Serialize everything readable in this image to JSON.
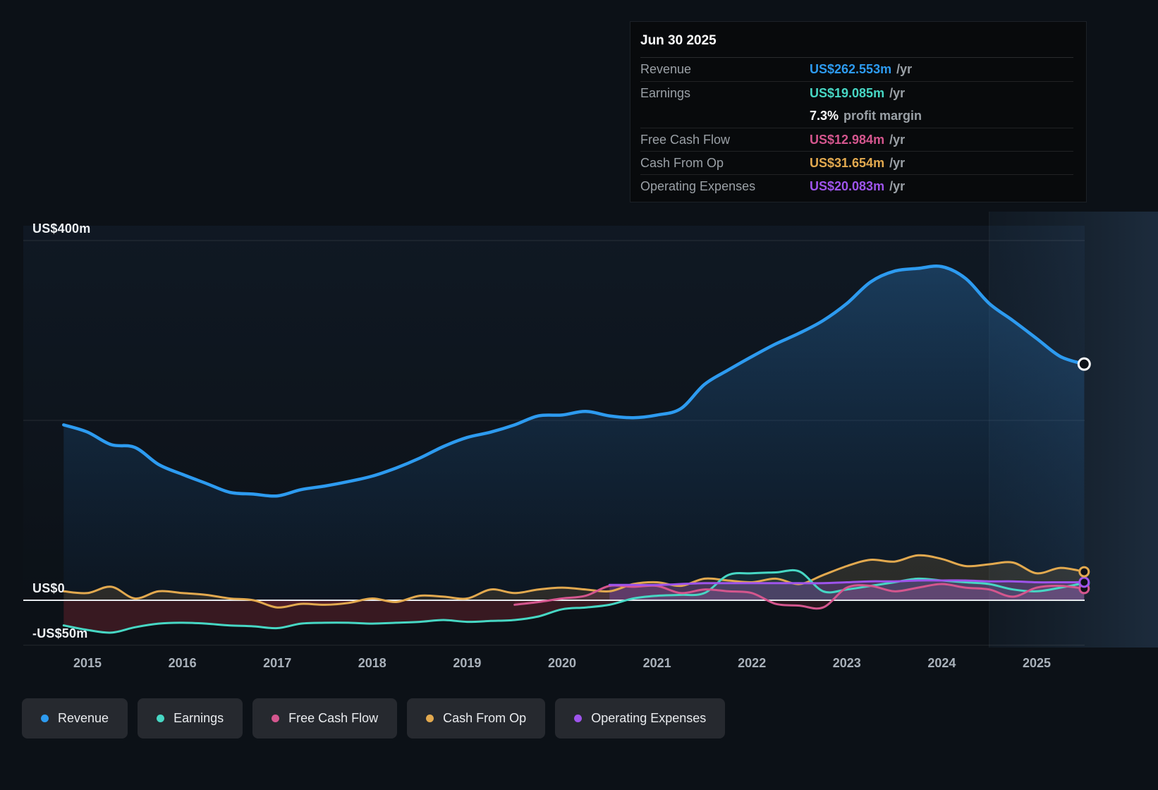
{
  "tooltip": {
    "date": "Jun 30 2025",
    "rows": [
      {
        "label": "Revenue",
        "value": "US$262.553m",
        "suffix": "/yr",
        "series": "revenue"
      },
      {
        "label": "Earnings",
        "value": "US$19.085m",
        "suffix": "/yr",
        "series": "earnings"
      },
      {
        "label": "",
        "value": "7.3%",
        "suffix": "profit margin",
        "series": "margin"
      },
      {
        "label": "Free Cash Flow",
        "value": "US$12.984m",
        "suffix": "/yr",
        "series": "fcf"
      },
      {
        "label": "Cash From Op",
        "value": "US$31.654m",
        "suffix": "/yr",
        "series": "cashop"
      },
      {
        "label": "Operating Expenses",
        "value": "US$20.083m",
        "suffix": "/yr",
        "series": "opex"
      }
    ]
  },
  "colors": {
    "revenue": "#2d9bf0",
    "earnings": "#47d7c4",
    "fcf": "#d4568e",
    "cashop": "#e2a94f",
    "opex": "#9e54ec",
    "margin": "#ffffff",
    "zero_line": "#e6eaee",
    "gridline": "rgba(255,255,255,0.10)"
  },
  "chart_data": {
    "type": "area",
    "unit": "US$m",
    "title": "",
    "xlabel": "",
    "ylabel": "",
    "ylim": [
      -75,
      430
    ],
    "xlim": [
      2014.3,
      2025.5
    ],
    "highlight_from": 2024.5,
    "x_ticks": [
      2015,
      2016,
      2017,
      2018,
      2019,
      2020,
      2021,
      2022,
      2023,
      2024,
      2025
    ],
    "y_gridlines": [
      {
        "value": 400,
        "label": "US$400m"
      },
      {
        "value": 200,
        "label": ""
      },
      {
        "value": 0,
        "label": "US$0"
      },
      {
        "value": -50,
        "label": "-US$50m"
      }
    ],
    "series": [
      {
        "id": "revenue",
        "name": "Revenue",
        "x": [
          2014.75,
          2015,
          2015.25,
          2015.5,
          2015.75,
          2016,
          2016.25,
          2016.5,
          2016.75,
          2017,
          2017.25,
          2017.5,
          2017.75,
          2018,
          2018.25,
          2018.5,
          2018.75,
          2019,
          2019.25,
          2019.5,
          2019.75,
          2020,
          2020.25,
          2020.5,
          2020.75,
          2021,
          2021.25,
          2021.5,
          2021.75,
          2022,
          2022.25,
          2022.5,
          2022.75,
          2023,
          2023.25,
          2023.5,
          2023.75,
          2024,
          2024.25,
          2024.5,
          2024.75,
          2025,
          2025.25,
          2025.5
        ],
        "values": [
          195,
          187,
          173,
          170,
          151,
          140,
          130,
          120,
          118,
          116,
          123,
          127,
          132,
          138,
          147,
          158,
          171,
          181,
          187,
          195,
          205,
          206,
          210,
          205,
          203,
          206,
          213,
          240,
          256,
          271,
          285,
          297,
          311,
          330,
          354,
          366,
          369,
          371,
          358,
          330,
          311,
          291,
          271,
          262.6
        ]
      },
      {
        "id": "earnings",
        "name": "Earnings",
        "x": [
          2014.75,
          2015,
          2015.25,
          2015.5,
          2015.75,
          2016,
          2016.25,
          2016.5,
          2016.75,
          2017,
          2017.25,
          2017.5,
          2017.75,
          2018,
          2018.25,
          2018.5,
          2018.75,
          2019,
          2019.25,
          2019.5,
          2019.75,
          2020,
          2020.25,
          2020.5,
          2020.75,
          2021,
          2021.25,
          2021.5,
          2021.75,
          2022,
          2022.25,
          2022.5,
          2022.75,
          2023,
          2023.25,
          2023.5,
          2023.75,
          2024,
          2024.25,
          2024.5,
          2024.75,
          2025,
          2025.25,
          2025.5
        ],
        "values": [
          -28,
          -33,
          -36,
          -30,
          -26,
          -25,
          -26,
          -28,
          -29,
          -31,
          -26,
          -25,
          -25,
          -26,
          -25,
          -24,
          -22,
          -24,
          -23,
          -22,
          -18,
          -10,
          -8,
          -5,
          2,
          5,
          6,
          8,
          28,
          30,
          31,
          32,
          10,
          12,
          16,
          20,
          24,
          22,
          20,
          18,
          12,
          10,
          14,
          19.1
        ]
      },
      {
        "id": "cashop",
        "name": "Cash From Op",
        "x": [
          2014.75,
          2015,
          2015.25,
          2015.5,
          2015.75,
          2016,
          2016.25,
          2016.5,
          2016.75,
          2017,
          2017.25,
          2017.5,
          2017.75,
          2018,
          2018.25,
          2018.5,
          2018.75,
          2019,
          2019.25,
          2019.5,
          2019.75,
          2020,
          2020.25,
          2020.5,
          2020.75,
          2021,
          2021.25,
          2021.5,
          2021.75,
          2022,
          2022.25,
          2022.5,
          2022.75,
          2023,
          2023.25,
          2023.5,
          2023.75,
          2024,
          2024.25,
          2024.5,
          2024.75,
          2025,
          2025.25,
          2025.5
        ],
        "values": [
          10,
          8,
          15,
          2,
          10,
          8,
          6,
          2,
          0,
          -8,
          -4,
          -5,
          -3,
          2,
          -2,
          5,
          4,
          2,
          12,
          8,
          12,
          14,
          12,
          10,
          18,
          20,
          16,
          24,
          22,
          20,
          24,
          18,
          28,
          38,
          45,
          43,
          50,
          46,
          38,
          40,
          42,
          30,
          36,
          31.7
        ]
      },
      {
        "id": "fcf",
        "name": "Free Cash Flow",
        "x": [
          2019.5,
          2019.75,
          2020,
          2020.25,
          2020.5,
          2020.75,
          2021,
          2021.25,
          2021.5,
          2021.75,
          2022,
          2022.25,
          2022.5,
          2022.75,
          2023,
          2023.25,
          2023.5,
          2023.75,
          2024,
          2024.25,
          2024.5,
          2024.75,
          2025,
          2025.25,
          2025.5
        ],
        "values": [
          -5,
          -2,
          2,
          5,
          16,
          15,
          16,
          8,
          12,
          10,
          8,
          -4,
          -6,
          -8,
          14,
          16,
          10,
          14,
          18,
          14,
          12,
          4,
          14,
          16,
          13
        ]
      },
      {
        "id": "opex",
        "name": "Operating Expenses",
        "x": [
          2020.5,
          2020.75,
          2021,
          2021.25,
          2021.5,
          2021.75,
          2022,
          2022.25,
          2022.5,
          2022.75,
          2023,
          2023.25,
          2023.5,
          2023.75,
          2024,
          2024.25,
          2024.5,
          2024.75,
          2025,
          2025.25,
          2025.5
        ],
        "values": [
          17,
          17,
          17,
          18,
          19,
          19,
          19,
          19,
          19,
          19,
          20,
          21,
          21,
          22,
          22,
          22,
          21,
          21,
          20,
          20,
          20.1
        ]
      }
    ]
  },
  "legend": {
    "items": [
      {
        "id": "revenue",
        "label": "Revenue"
      },
      {
        "id": "earnings",
        "label": "Earnings"
      },
      {
        "id": "fcf",
        "label": "Free Cash Flow"
      },
      {
        "id": "cashop",
        "label": "Cash From Op"
      },
      {
        "id": "opex",
        "label": "Operating Expenses"
      }
    ]
  }
}
